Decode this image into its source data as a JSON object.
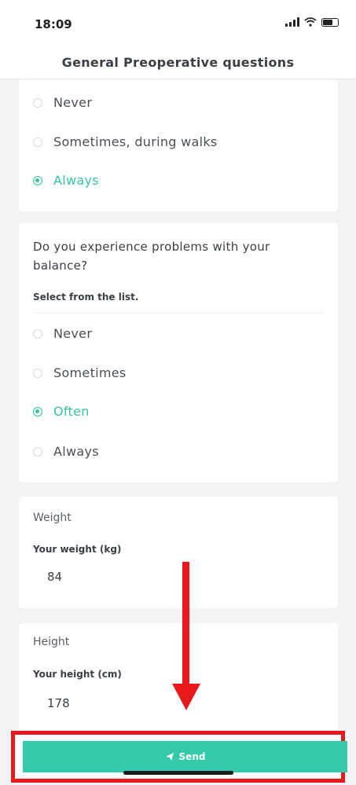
{
  "status_bar": {
    "time": "18:09"
  },
  "header": {
    "title": "General Preoperative questions"
  },
  "question1": {
    "options": [
      {
        "label": "Never",
        "selected": false
      },
      {
        "label": "Sometimes, during walks",
        "selected": false
      },
      {
        "label": "Always",
        "selected": true
      }
    ]
  },
  "question2": {
    "text": "Do you experience problems with your balance?",
    "hint": "Select from the list.",
    "options": [
      {
        "label": "Never",
        "selected": false
      },
      {
        "label": "Sometimes",
        "selected": false
      },
      {
        "label": "Often",
        "selected": true
      },
      {
        "label": "Always",
        "selected": false
      }
    ]
  },
  "weight": {
    "title": "Weight",
    "label": "Your weight (kg)",
    "value": "84"
  },
  "height": {
    "title": "Height",
    "label": "Your height (cm)",
    "value": "178"
  },
  "footer": {
    "send_label": "Send"
  },
  "colors": {
    "accent": "#35c3a4",
    "annotation_red": "#e8191d"
  },
  "icons": {
    "send": "paper-plane-icon",
    "signal": "signal-icon",
    "wifi": "wifi-icon",
    "battery": "battery-icon"
  }
}
